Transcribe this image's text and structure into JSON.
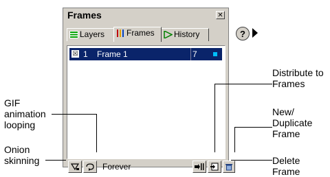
{
  "panel": {
    "title": "Frames",
    "close_glyph": "✕",
    "tabs": [
      {
        "label": "Layers",
        "icon": "layers-icon"
      },
      {
        "label": "Frames",
        "icon": "frames-icon"
      },
      {
        "label": "History",
        "icon": "history-icon"
      }
    ],
    "help_label": "?",
    "frame_rows": [
      {
        "number": "1",
        "name": "Frame 1",
        "delay": "7",
        "selected": true
      }
    ],
    "looping_value": "Forever"
  },
  "colors": {
    "selection": "#0a246a",
    "panel_bg": "#d4d0c8",
    "swatch": "#00c0ff"
  },
  "callouts": {
    "distribute_line1": "Distribute to",
    "distribute_line2": "Frames",
    "new_line1": "New/",
    "new_line2": "Duplicate",
    "new_line3": "Frame",
    "gif_line1": "GIF",
    "gif_line2": "animation",
    "gif_line3": "looping",
    "onion_line1": "Onion",
    "onion_line2": "skinning",
    "delete_line1": "Delete",
    "delete_line2": "Frame"
  }
}
